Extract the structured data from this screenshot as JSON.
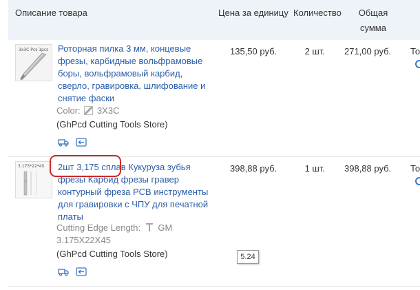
{
  "table": {
    "headers": {
      "description": "Описание товара",
      "unit_price": "Цена за единицу",
      "quantity": "Количество",
      "total_line1": "Общая",
      "total_line2": "сумма"
    }
  },
  "items": [
    {
      "name": "Роторная пилка 3 мм, концевые фрезы, карбидные вольфрамовые боры, вольфрамовый карбид, сверло, гравировка, шлифование и снятие фаски",
      "attr_label": "Color:",
      "attr_value": "3X3C",
      "store": "(GhPcd Cutting Tools Store)",
      "price": "135,50 руб.",
      "qty": "2 шт.",
      "total": "271,00 руб.",
      "cut_text": "То"
    },
    {
      "name": "2шт 3,175 сплав Кукуруза зубья фрезы Карбид фрезы гравер контурный фреза PCB инструменты для гравировки с ЧПУ для печатной платы",
      "attr_label": "Cutting Edge Length:",
      "attr_value": "GM",
      "attr_value2": "3.175X22X45",
      "store": "(GhPcd Cutting Tools Store)",
      "price": "398,88 руб.",
      "qty": "1 шт.",
      "total": "398,88 руб.",
      "cut_text": "То"
    }
  ],
  "tooltip": "5.24",
  "icons": [
    "shipping-truck-icon",
    "back-arrow-icon",
    "rotate-icon",
    "tool-thumb-icon"
  ]
}
